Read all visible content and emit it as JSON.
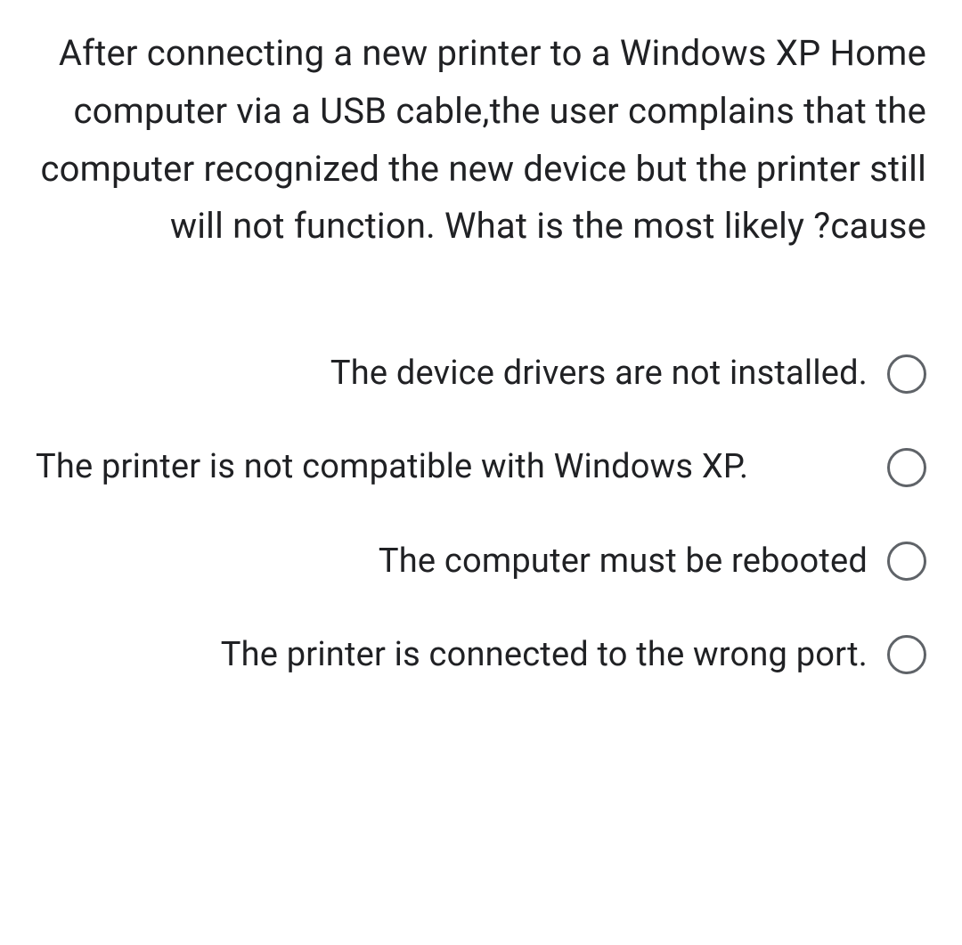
{
  "question": "After connecting a new printer to a Windows XP Home computer via a USB cable,the user complains that the computer recognized the new device but the printer still will not function. What is the most likely ?cause",
  "options": [
    {
      "label": "The device drivers are not installed.",
      "align": "right"
    },
    {
      "label": "The printer is not compatible with Windows XP.",
      "align": "left"
    },
    {
      "label": "The computer must be rebooted",
      "align": "right"
    },
    {
      "label": "The printer is connected to the wrong port.",
      "align": "right"
    }
  ]
}
